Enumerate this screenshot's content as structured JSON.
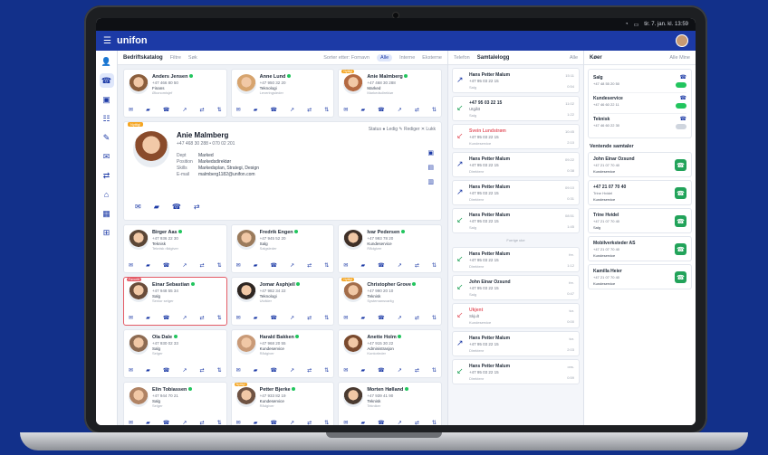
{
  "system": {
    "time": "tir. 7. jan. kl. 13:59"
  },
  "app": {
    "brand": "unifon",
    "menu_icon": "☰"
  },
  "nav": [
    "👤",
    "☎",
    "▣",
    "☷",
    "✎",
    "✉",
    "⇄",
    "⌂",
    "▦",
    "⊞"
  ],
  "company": {
    "title": "Bedriftskatalog",
    "filter_label": "Filtre",
    "search_label": "Søk",
    "sort_label": "Sorter etter: Fornavn",
    "chips": [
      "Alle",
      "Interne",
      "Eksterne"
    ]
  },
  "detail": {
    "tag": "Nyttig!",
    "name": "Anie Malmberg",
    "phone": "+47 468 30 288  •  070 02 201",
    "fields": [
      {
        "k": "Dept",
        "v": "Marked"
      },
      {
        "k": "Position",
        "v": "Markedsdirektør"
      },
      {
        "k": "Skills",
        "v": "Markedsplan, Strategi, Design"
      },
      {
        "k": "E-mail",
        "v": "malmberg1182@unifon.com"
      }
    ],
    "tools": "Status ● Ledig  ✎ Rediger  ✕ Lukk"
  },
  "cards_top": [
    {
      "name": "Anders Jensen",
      "phone": "+47 466 80 50",
      "dept": "Finans",
      "role": "Økonomisjef",
      "tag": "",
      "color": "#8b5e3c"
    },
    {
      "name": "Anne Lund",
      "phone": "+47 950 32 20",
      "dept": "Teknologi",
      "role": "Leveringsleder",
      "tag": "",
      "color": "#d7a46e"
    },
    {
      "name": "Anie Malmberg",
      "phone": "+47 468 30 288",
      "dept": "Marked",
      "role": "Markedsdirektør",
      "tag": "Nyttig!",
      "color": "#b46a42"
    }
  ],
  "cards": [
    {
      "name": "Birger Aas",
      "phone": "+47 936 22 30",
      "dept": "Teknisk",
      "role": "Teknisk rådgiver",
      "tag": "",
      "color": "#5b4636",
      "hl": false
    },
    {
      "name": "Fredrik Engen",
      "phone": "+47 945 52 20",
      "dept": "Salg",
      "role": "Salgsleder",
      "tag": "",
      "color": "#9b7b5c",
      "hl": false
    },
    {
      "name": "Ivar Pedersen",
      "phone": "+47 993 78 20",
      "dept": "Kundeservice",
      "role": "Rådgiver",
      "tag": "",
      "color": "#3f3027",
      "hl": false
    },
    {
      "name": "Einar Sebastian",
      "phone": "+47 948 55 34",
      "dept": "Salg",
      "role": "Senior selger",
      "tag": "Favoritt",
      "color": "#6a4c3a",
      "hl": true
    },
    {
      "name": "Jomar Asphjell",
      "phone": "+47 982 34 22",
      "dept": "Teknologi",
      "role": "Utvikler",
      "tag": "",
      "color": "#2e2622",
      "hl": false
    },
    {
      "name": "Christopher Grove",
      "phone": "+47 990 20 10",
      "dept": "Teknisk",
      "role": "Systemansvarlig",
      "tag": "Nyttig!",
      "color": "#a36d4a",
      "hl": false
    },
    {
      "name": "Ola Dale",
      "phone": "+47 930 02 33",
      "dept": "Salg",
      "role": "Selger",
      "tag": "",
      "color": "#8d6b52",
      "hl": false
    },
    {
      "name": "Harald Bakken",
      "phone": "+47 968 20 55",
      "dept": "Kundeservice",
      "role": "Rådgiver",
      "tag": "",
      "color": "#c99a77",
      "hl": false
    },
    {
      "name": "Anette Holm",
      "phone": "+47 915 30 22",
      "dept": "Administrasjon",
      "role": "Kontorleder",
      "tag": "",
      "color": "#7a4a2e",
      "hl": false
    },
    {
      "name": "Elin Tobiassen",
      "phone": "+47 944 70 21",
      "dept": "Salg",
      "role": "Selger",
      "tag": "",
      "color": "#b08364",
      "hl": false
    },
    {
      "name": "Petter Bjerke",
      "phone": "+47 933 82 19",
      "dept": "Kundeservice",
      "role": "Rådgiver",
      "tag": "Nyttig!",
      "color": "#6f5343",
      "hl": false
    },
    {
      "name": "Morten Hølland",
      "phone": "+47 939 41 90",
      "dept": "Teknisk",
      "role": "Tekniker",
      "tag": "",
      "color": "#4a3a30",
      "hl": false
    }
  ],
  "calls": {
    "tab1": "Telefon",
    "tab2": "Samtalelogg",
    "filter": "Alle",
    "divider": "Forrige uke",
    "items": [
      {
        "name": "Hans Petter Malum",
        "num": "+47 95 03 22 15",
        "queue": "Salg",
        "time": "15:11",
        "dur": "0:54",
        "type": "out"
      },
      {
        "name": "+47 95 03 22 15",
        "num": "Utgått",
        "queue": "Salg",
        "time": "11:02",
        "dur": "1:22",
        "type": "in"
      },
      {
        "name": "Svein Lundstrøm",
        "num": "+47 95 03 22 15",
        "queue": "Kundeservice",
        "time": "10:45",
        "dur": "2:10",
        "type": "missed"
      },
      {
        "name": "Hans Petter Malum",
        "num": "+47 95 03 22 15",
        "queue": "Direktenr",
        "time": "09:22",
        "dur": "0:38",
        "type": "out"
      },
      {
        "name": "Hans Petter Malum",
        "num": "+47 95 03 22 15",
        "queue": "Direktenr",
        "time": "09:10",
        "dur": "0:31",
        "type": "out"
      },
      {
        "name": "Hans Petter Malum",
        "num": "+47 95 03 22 15",
        "queue": "Salg",
        "time": "08:51",
        "dur": "1:45",
        "type": "in"
      },
      {
        "name": "Hans Petter Malum",
        "num": "+47 95 03 22 15",
        "queue": "Direktenr",
        "time": "fre.",
        "dur": "1:12",
        "type": "in"
      },
      {
        "name": "John Einar Ozsund",
        "num": "+47 95 03 22 15",
        "queue": "Salg",
        "time": "fre.",
        "dur": "0:47",
        "type": "in"
      },
      {
        "name": "Ukjent",
        "num": "Skjult",
        "queue": "Kundeservice",
        "time": "tor.",
        "dur": "0:00",
        "type": "missed"
      },
      {
        "name": "Hans Petter Malum",
        "num": "+47 95 03 22 15",
        "queue": "Direktenr",
        "time": "tor.",
        "dur": "2:03",
        "type": "out"
      },
      {
        "name": "Hans Petter Malum",
        "num": "+47 95 03 22 15",
        "queue": "Direktenr",
        "time": "ons.",
        "dur": "0:59",
        "type": "in"
      }
    ]
  },
  "queues": {
    "title": "Køer",
    "tabs": "Alle  Mine",
    "list": [
      {
        "name": "Salg",
        "num": "+47 48 55 20 50",
        "on": true
      },
      {
        "name": "Kundeservice",
        "num": "+47 46 60 22 11",
        "on": true
      },
      {
        "name": "Teknisk",
        "num": "+47 46 60 22 30",
        "on": false
      }
    ],
    "waiting_title": "Ventende samtaler",
    "waiting": [
      {
        "name": "John Einar Ozsund",
        "num": "+47 21 07 70 40",
        "queue": "Kundeservice"
      },
      {
        "name": "+47 21 07 70 40",
        "num": "Trine Hvidel",
        "queue": "Kundeservice"
      },
      {
        "name": "Trine Hvidel",
        "num": "+47 21 07 70 40",
        "queue": "Salg"
      },
      {
        "name": "Mobilverksteder AS",
        "num": "+47 21 07 70 40",
        "queue": "Kundeservice"
      },
      {
        "name": "Kamilla Heier",
        "num": "+47 21 07 70 40",
        "queue": "Kundeservice"
      }
    ]
  }
}
